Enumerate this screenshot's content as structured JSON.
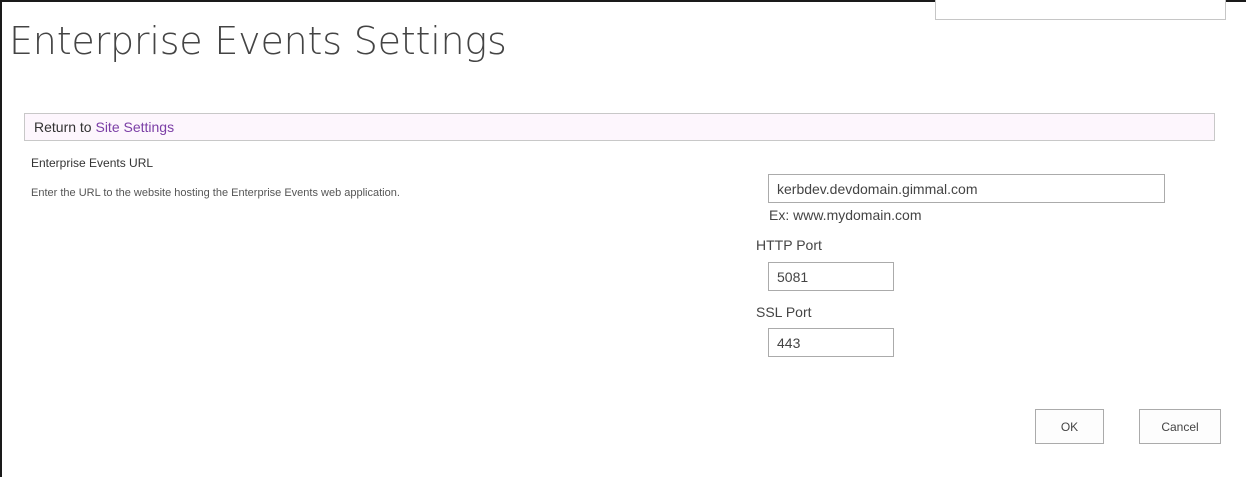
{
  "page": {
    "title": "Enterprise Events Settings"
  },
  "return_bar": {
    "prefix": "Return to ",
    "link_label": "Site Settings"
  },
  "section": {
    "title": "Enterprise Events URL",
    "description": "Enter the URL to the website hosting the Enterprise Events web application."
  },
  "form": {
    "url_value": "kerbdev.devdomain.gimmal.com",
    "url_hint": "Ex: www.mydomain.com",
    "http_port_label": "HTTP Port",
    "http_port_value": "5081",
    "ssl_port_label": "SSL Port",
    "ssl_port_value": "443"
  },
  "buttons": {
    "ok_label": "OK",
    "cancel_label": "Cancel"
  },
  "colors": {
    "link": "#7b3ea6",
    "return_bar_bg": "#fdf6fd"
  }
}
